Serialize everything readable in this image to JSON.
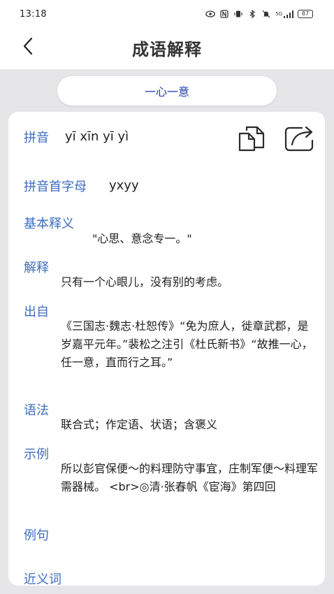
{
  "status": {
    "time": "13:18",
    "signal": "5G",
    "battery": "87"
  },
  "nav": {
    "title": "成语解释"
  },
  "idiom": "一心一意",
  "detail": {
    "pinyin_label": "拼音",
    "pinyin": "yī xīn yī yì",
    "initials_label": "拼音首字母",
    "initials": "yxyy",
    "basic_label": "基本释义",
    "basic": "\"心思、意念专一。\"",
    "explain_label": "解释",
    "explain": "只有一个心眼儿，没有别的考虑。",
    "source_label": "出自",
    "source": "《三国志·魏志·杜恕传》“免为庶人，徙章武郡，是岁嘉平元年。”裴松之注引《杜氏新书》“故推一心，任一意，直而行之耳。”",
    "grammar_label": "语法",
    "grammar": "联合式；作定语、状语；含褒义",
    "example_label": "示例",
    "example": "所以彭官保便～的料理防守事宜，庄制军便～料理军需器械。 <br>◎清·张春帆《宦海》第四回",
    "sentence_label": "例句",
    "synonym_label": "近义词"
  },
  "icons": {
    "back": "back-arrow-icon",
    "copy": "copy-icon",
    "share": "share-icon"
  },
  "colors": {
    "label_blue": "#3b6ec0",
    "idiom_blue": "#1d3fa8",
    "page_bg": "#e6e6e8"
  }
}
